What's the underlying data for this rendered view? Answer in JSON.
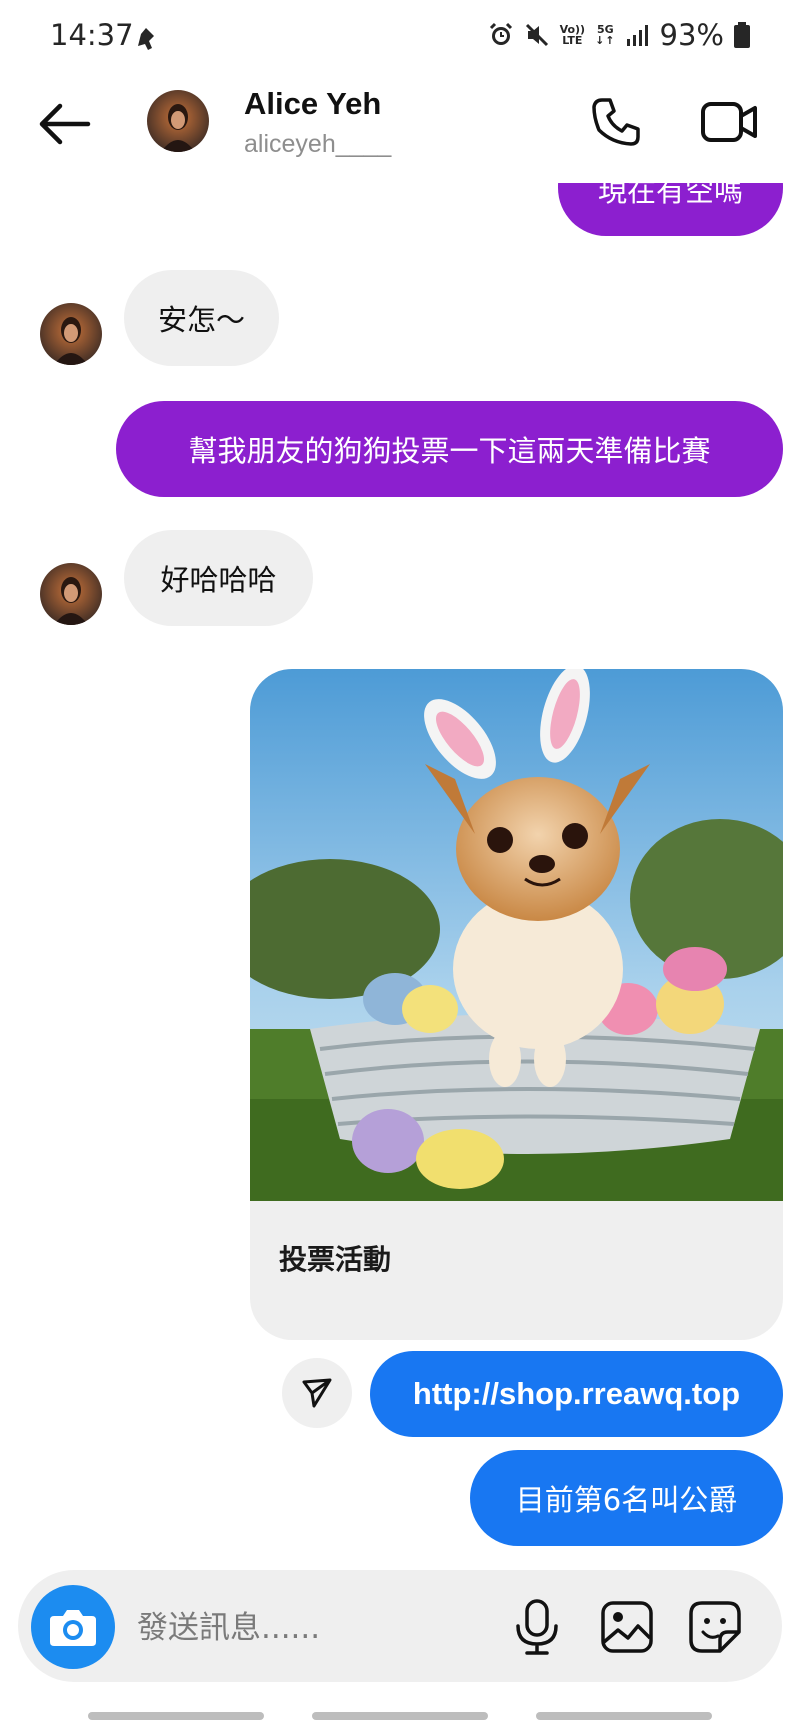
{
  "status_bar": {
    "time": "14:37",
    "network_top": "Vo))",
    "network_bottom": "LTE",
    "gen_label": "5G",
    "battery": "93%"
  },
  "header": {
    "name": "Alice Yeh",
    "username": "aliceyeh____"
  },
  "messages": [
    {
      "side": "out",
      "text": "現在有空嗎"
    },
    {
      "side": "in",
      "text": "安怎～"
    },
    {
      "side": "out",
      "text": "幫我朋友的狗狗投票一下這兩天準備比賽"
    },
    {
      "side": "in",
      "text": "好哈哈哈"
    },
    {
      "side": "out",
      "type": "image-card",
      "caption": "投票活動"
    },
    {
      "side": "out",
      "text": "http://shop.rreawq.top"
    },
    {
      "side": "out",
      "text": "目前第6名叫公爵"
    }
  ],
  "composer": {
    "placeholder": "發送訊息......"
  },
  "colors": {
    "outgoing_purple": "#8c1fcf",
    "outgoing_blue": "#1877f2",
    "incoming_gray": "#efefef",
    "camera_blue": "#1c8cf0"
  },
  "icons": [
    "back-arrow-icon",
    "phone-icon",
    "video-camera-icon",
    "send-icon",
    "camera-icon",
    "microphone-icon",
    "gallery-icon",
    "sticker-icon",
    "alarm-icon",
    "mute-icon",
    "signal-icon",
    "battery-icon"
  ]
}
